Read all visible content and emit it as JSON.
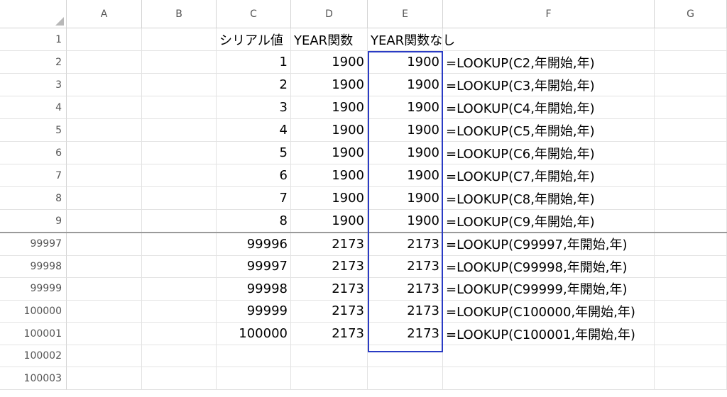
{
  "columns": [
    "A",
    "B",
    "C",
    "D",
    "E",
    "F",
    "G"
  ],
  "top_rows": [
    {
      "num": "1",
      "c": "シリアル値",
      "d": "YEAR関数",
      "e": "YEAR関数なし",
      "f": ""
    },
    {
      "num": "2",
      "c": "1",
      "d": "1900",
      "e": "1900",
      "f": "=LOOKUP(C2,年開始,年)"
    },
    {
      "num": "3",
      "c": "2",
      "d": "1900",
      "e": "1900",
      "f": "=LOOKUP(C3,年開始,年)"
    },
    {
      "num": "4",
      "c": "3",
      "d": "1900",
      "e": "1900",
      "f": "=LOOKUP(C4,年開始,年)"
    },
    {
      "num": "5",
      "c": "4",
      "d": "1900",
      "e": "1900",
      "f": "=LOOKUP(C5,年開始,年)"
    },
    {
      "num": "6",
      "c": "5",
      "d": "1900",
      "e": "1900",
      "f": "=LOOKUP(C6,年開始,年)"
    },
    {
      "num": "7",
      "c": "6",
      "d": "1900",
      "e": "1900",
      "f": "=LOOKUP(C7,年開始,年)"
    },
    {
      "num": "8",
      "c": "7",
      "d": "1900",
      "e": "1900",
      "f": "=LOOKUP(C8,年開始,年)"
    },
    {
      "num": "9",
      "c": "8",
      "d": "1900",
      "e": "1900",
      "f": "=LOOKUP(C9,年開始,年)"
    }
  ],
  "bottom_rows": [
    {
      "num": "99997",
      "c": "99996",
      "d": "2173",
      "e": "2173",
      "f": "=LOOKUP(C99997,年開始,年)"
    },
    {
      "num": "99998",
      "c": "99997",
      "d": "2173",
      "e": "2173",
      "f": "=LOOKUP(C99998,年開始,年)"
    },
    {
      "num": "99999",
      "c": "99998",
      "d": "2173",
      "e": "2173",
      "f": "=LOOKUP(C99999,年開始,年)"
    },
    {
      "num": "100000",
      "c": "99999",
      "d": "2173",
      "e": "2173",
      "f": "=LOOKUP(C100000,年開始,年)"
    },
    {
      "num": "100001",
      "c": "100000",
      "d": "2173",
      "e": "2173",
      "f": "=LOOKUP(C100001,年開始,年)"
    },
    {
      "num": "100002",
      "c": "",
      "d": "",
      "e": "",
      "f": ""
    },
    {
      "num": "100003",
      "c": "",
      "d": "",
      "e": "",
      "f": ""
    }
  ],
  "selection": {
    "color": "#2a3bc4"
  }
}
